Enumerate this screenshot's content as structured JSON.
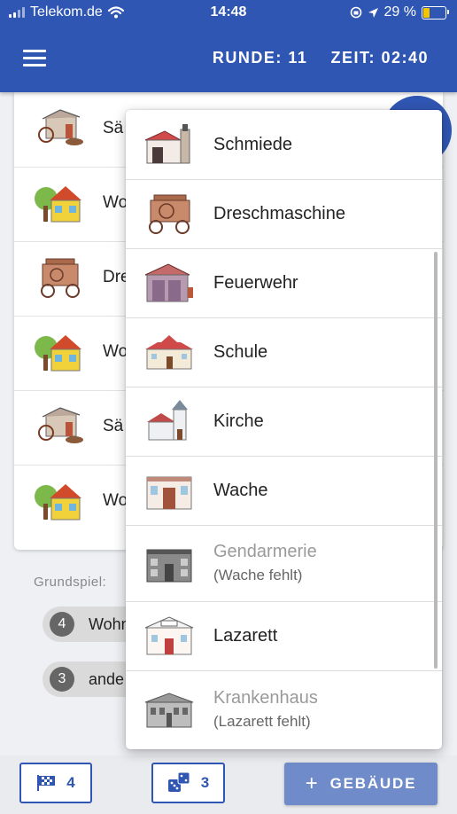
{
  "status_bar": {
    "carrier": "Telekom.de",
    "time": "14:48",
    "battery": "29 %"
  },
  "header": {
    "round_label": "RUNDE: 11",
    "time_label": "ZEIT: 02:40"
  },
  "building_list": [
    {
      "label": "Sä",
      "icon": "sawmill-icon"
    },
    {
      "label": "Wo",
      "icon": "house-icon"
    },
    {
      "label": "Dre",
      "icon": "thresher-icon"
    },
    {
      "label": "Wo",
      "icon": "house-icon"
    },
    {
      "label": "Sä",
      "icon": "sawmill-icon"
    },
    {
      "label": "Wo",
      "icon": "house-icon"
    }
  ],
  "grundspiel": {
    "label": "Grundspiel:",
    "chips": [
      {
        "count": "4",
        "text": "Wohn"
      },
      {
        "count": "3",
        "text": "ande"
      }
    ]
  },
  "dropdown": {
    "items": [
      {
        "name": "Schmiede",
        "note": "",
        "enabled": true,
        "icon": "smithy-icon"
      },
      {
        "name": "Dreschmaschine",
        "note": "",
        "enabled": true,
        "icon": "thresher-icon"
      },
      {
        "name": "Feuerwehr",
        "note": "",
        "enabled": true,
        "icon": "fire-station-icon"
      },
      {
        "name": "Schule",
        "note": "",
        "enabled": true,
        "icon": "school-icon"
      },
      {
        "name": "Kirche",
        "note": "",
        "enabled": true,
        "icon": "church-icon"
      },
      {
        "name": "Wache",
        "note": "",
        "enabled": true,
        "icon": "guardhouse-icon"
      },
      {
        "name": "Gendarmerie",
        "note": "(Wache fehlt)",
        "enabled": false,
        "icon": "gendarmerie-icon"
      },
      {
        "name": "Lazarett",
        "note": "",
        "enabled": true,
        "icon": "field-hospital-icon"
      },
      {
        "name": "Krankenhaus",
        "note": "(Lazarett fehlt)",
        "enabled": false,
        "icon": "hospital-icon"
      }
    ]
  },
  "bottom_bar": {
    "flag_count": "4",
    "dice_count": "3",
    "add_label": "GEBÄUDE"
  },
  "colors": {
    "primary": "#2f56b3",
    "add_button": "#6f8bc9",
    "disabled_text": "#9a9a9a"
  }
}
